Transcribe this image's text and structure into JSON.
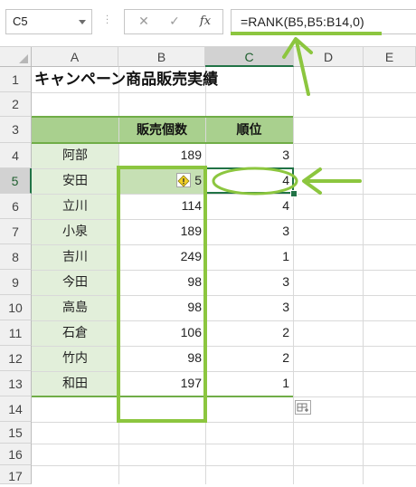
{
  "formula_bar": {
    "name_box": "C5",
    "cancel_symbol": "✕",
    "enter_symbol": "✓",
    "fx_label": "fx",
    "formula": "=RANK(B5,B5:B14,0)"
  },
  "columns": [
    "A",
    "B",
    "C",
    "D",
    "E"
  ],
  "rows": [
    "1",
    "2",
    "3",
    "4",
    "5",
    "6",
    "7",
    "8",
    "9",
    "10",
    "11",
    "12",
    "13",
    "14",
    "15",
    "16",
    "17"
  ],
  "sheet": {
    "title": "キャンペーン商品販売実績",
    "header_sales": "販売個数",
    "header_rank": "順位",
    "records": [
      {
        "name": "阿部",
        "sales": "189",
        "rank": "3"
      },
      {
        "name": "安田",
        "sales": "5",
        "rank": "4"
      },
      {
        "name": "立川",
        "sales": "114",
        "rank": "4"
      },
      {
        "name": "小泉",
        "sales": "189",
        "rank": "3"
      },
      {
        "name": "吉川",
        "sales": "249",
        "rank": "1"
      },
      {
        "name": "今田",
        "sales": "98",
        "rank": "3"
      },
      {
        "name": "高島",
        "sales": "98",
        "rank": "3"
      },
      {
        "name": "石倉",
        "sales": "106",
        "rank": "2"
      },
      {
        "name": "竹内",
        "sales": "98",
        "rank": "2"
      },
      {
        "name": "和田",
        "sales": "197",
        "rank": "1"
      }
    ]
  },
  "colors": {
    "header_fill": "#a9d08e",
    "name_fill": "#e2efda",
    "highlight_fill": "#c6e0b4",
    "annotation": "#8cc63f",
    "selection": "#217346"
  },
  "icons": {
    "warning": "diamond-warning-icon",
    "quick_analysis": "quick-analysis-icon"
  }
}
